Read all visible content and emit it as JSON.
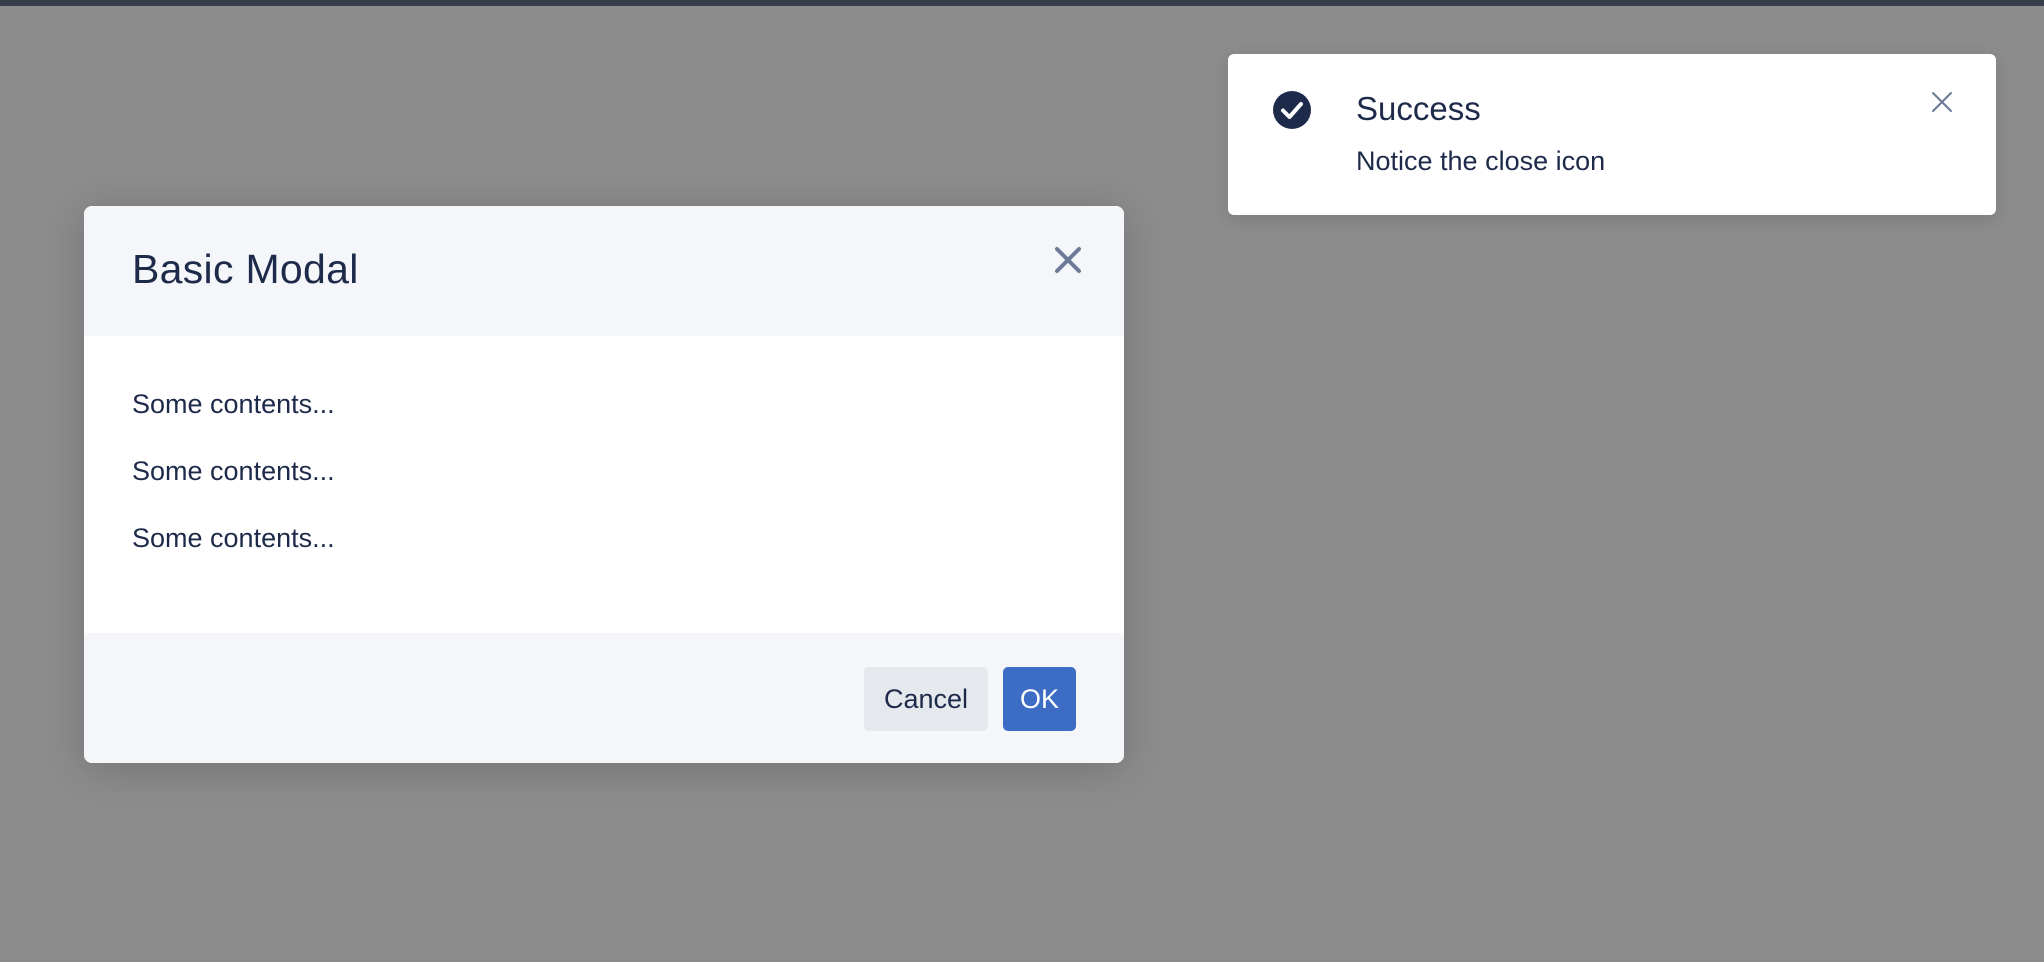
{
  "modal": {
    "title": "Basic Modal",
    "close_icon": "close-icon",
    "body": [
      "Some contents...",
      "Some contents...",
      "Some contents..."
    ],
    "footer": {
      "cancel_label": "Cancel",
      "ok_label": "OK"
    }
  },
  "notification": {
    "icon": "check-circle-icon",
    "title": "Success",
    "description": "Notice the close icon",
    "close_icon": "close-icon"
  },
  "colors": {
    "overlay": "#8c8c8c",
    "text": "#1e2a4a",
    "primary": "#3d6cc4",
    "secondary_button": "#e5e8ed",
    "header_footer_bg": "#f4f6f9",
    "top_bar": "#363c4a"
  }
}
